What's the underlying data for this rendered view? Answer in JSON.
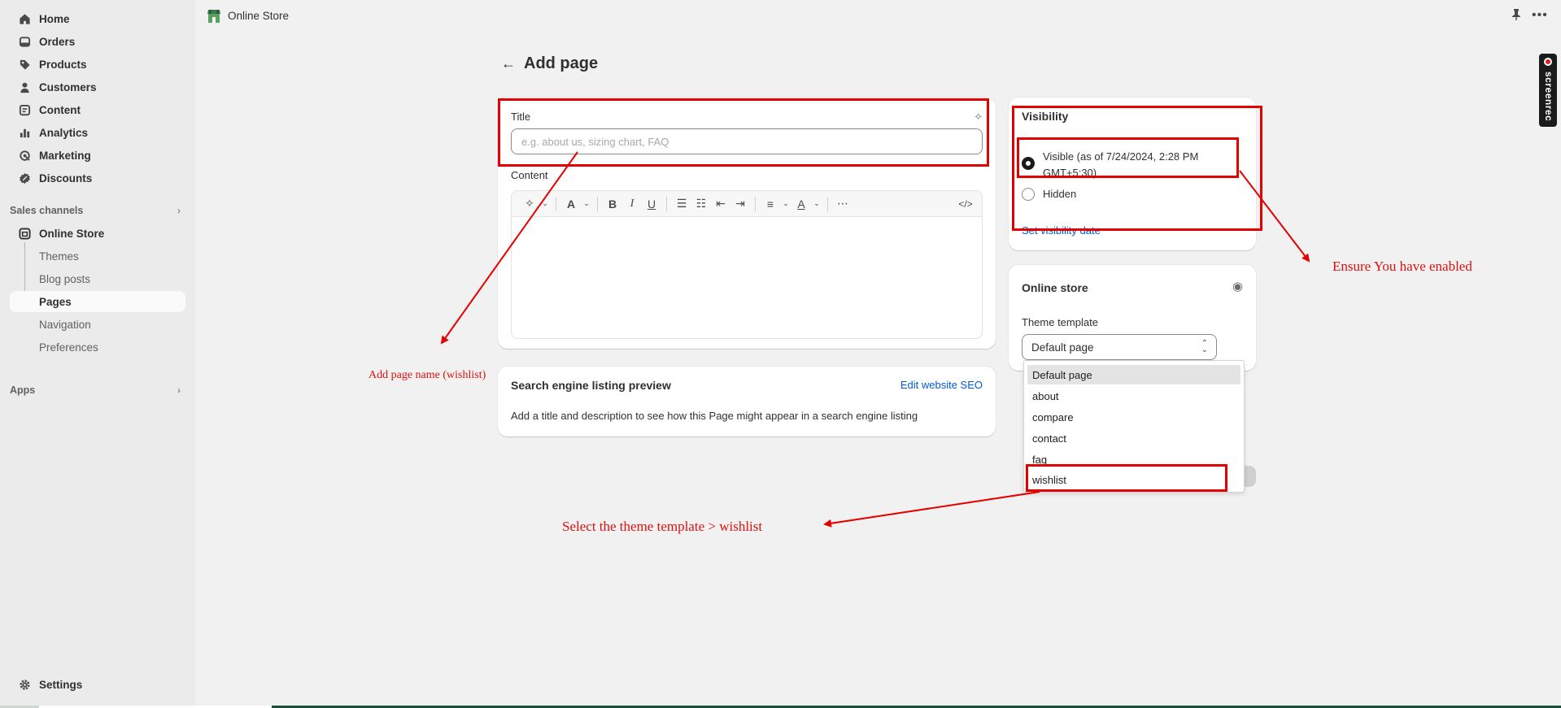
{
  "topbar": {
    "store_name": "Online Store"
  },
  "sidebar": {
    "items": [
      {
        "label": "Home",
        "icon": "home-icon"
      },
      {
        "label": "Orders",
        "icon": "orders-icon"
      },
      {
        "label": "Products",
        "icon": "tag-icon"
      },
      {
        "label": "Customers",
        "icon": "person-icon"
      },
      {
        "label": "Content",
        "icon": "content-icon"
      },
      {
        "label": "Analytics",
        "icon": "bar-chart-icon"
      },
      {
        "label": "Marketing",
        "icon": "target-icon"
      },
      {
        "label": "Discounts",
        "icon": "discount-icon"
      }
    ],
    "sales_channels_label": "Sales channels",
    "online_store_label": "Online Store",
    "sub_items": [
      "Themes",
      "Blog posts",
      "Pages",
      "Navigation",
      "Preferences"
    ],
    "active_sub": "Pages",
    "apps_label": "Apps",
    "settings_label": "Settings"
  },
  "page": {
    "title": "Add page"
  },
  "title_card": {
    "title_label": "Title",
    "title_placeholder": "e.g. about us, sizing chart, FAQ",
    "title_value": "",
    "content_label": "Content"
  },
  "seo_card": {
    "heading": "Search engine listing preview",
    "edit_link": "Edit website SEO",
    "description": "Add a title and description to see how this Page might appear in a search engine listing"
  },
  "visibility_card": {
    "heading": "Visibility",
    "visible_label_line1": "Visible (as of 7/24/2024, 2:28 PM",
    "visible_label_line2": "GMT+5:30)",
    "hidden_label": "Hidden",
    "set_date_link": "Set visibility date",
    "selected": "visible"
  },
  "online_store_card": {
    "heading": "Online store",
    "template_label": "Theme template",
    "template_value": "Default page",
    "options": [
      "Default page",
      "about",
      "compare",
      "contact",
      "faq",
      "wishlist"
    ]
  },
  "annotations": {
    "page_name": "Add page name (wishlist)",
    "enabled": "Ensure You have enabled",
    "template": "Select the theme template > wishlist",
    "color": "#e50000"
  },
  "watermark": {
    "text": "screenrec"
  }
}
